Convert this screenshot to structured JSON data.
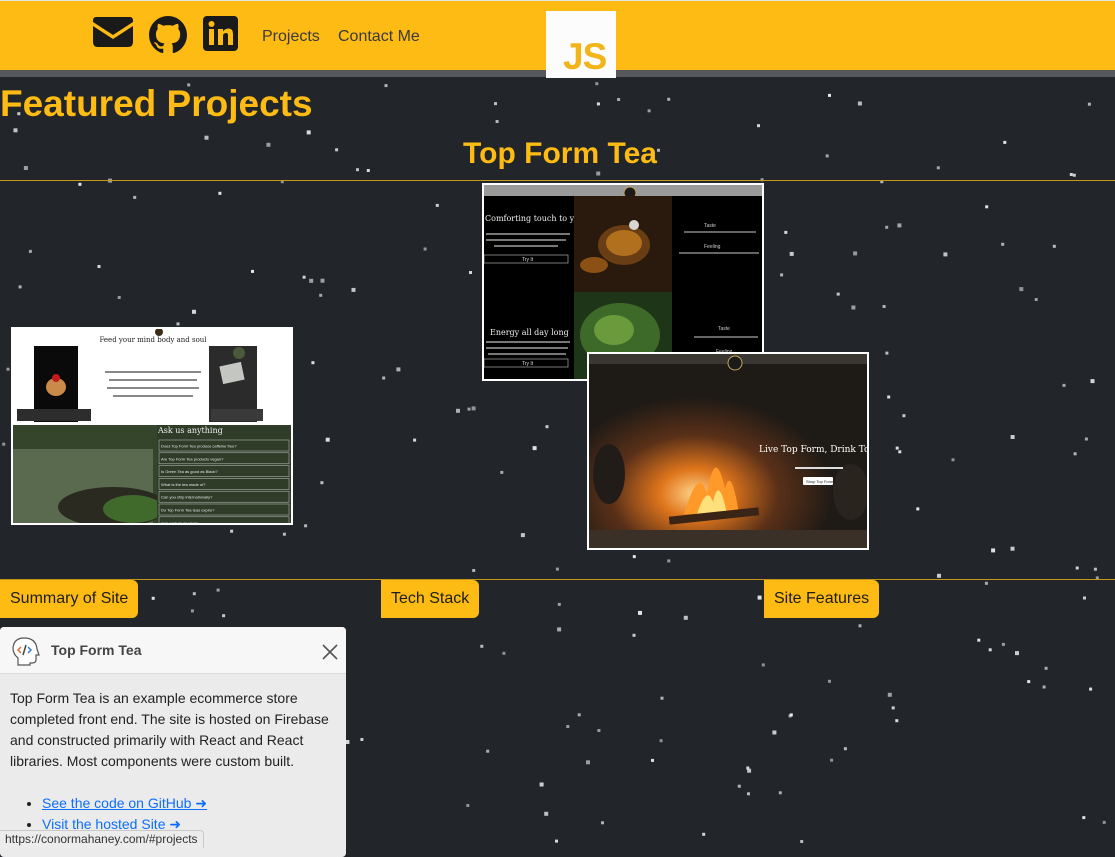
{
  "nav": {
    "email_icon": "envelope-icon",
    "github_icon": "github-icon",
    "linkedin_icon": "linkedin-icon",
    "links": [
      "Projects",
      "Contact Me"
    ],
    "logo_text": "JS"
  },
  "page": {
    "featured_title": "Featured Projects",
    "project_title": "Top Form Tea"
  },
  "screenshots": {
    "shot1": {
      "heading": "Feed your mind body and soul",
      "faq_heading": "Ask us anything",
      "faq_items": [
        "Does Top Form Tea produce caffeine free?",
        "Are Top Form Tea products vegan?",
        "Is Green Tea as good as Black?",
        "What is the tea made of?",
        "Can you ship internationally?",
        "Do Top Form Tea teas expire?",
        "Can I return my tea?"
      ]
    },
    "shot2": {
      "heading1": "Comforting touch to your routine",
      "heading2": "Energy all day long",
      "side_items": [
        "Taste",
        "Feeling",
        "Taste",
        "Feeling"
      ],
      "button": "Try It"
    },
    "shot3": {
      "hero_line": "Live Top Form, Drink Top Form",
      "hero_button": "Shop Top Form"
    }
  },
  "tabs": [
    "Summary of Site",
    "Tech Stack",
    "Site Features"
  ],
  "toast": {
    "title": "Top Form Tea",
    "body": "Top Form Tea is an example ecommerce store completed front end. The site is hosted on Firebase and constructed primarily with React and React libraries. Most components were custom built.",
    "links": [
      "See the code on GitHub ➜",
      "Visit the hosted Site ➜"
    ]
  },
  "status_url": "https://conormahaney.com/#projects",
  "colors": {
    "accent": "#fdbb13",
    "background": "#22252a",
    "link": "#0d6efd"
  }
}
